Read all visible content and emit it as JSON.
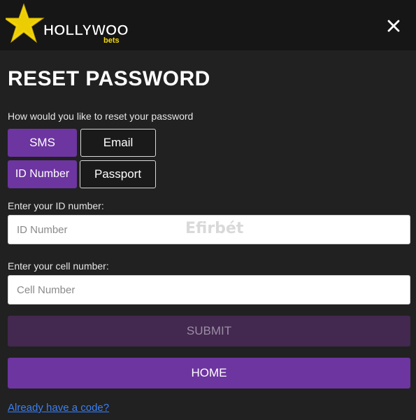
{
  "header": {
    "logo_main": "HOLLYWOOD",
    "logo_sub": "bets",
    "close_icon": "close-icon"
  },
  "page": {
    "title": "RESET PASSWORD",
    "prompt": "How would you like to reset your password"
  },
  "method_options": [
    {
      "label": "SMS",
      "selected": true
    },
    {
      "label": "Email",
      "selected": false
    }
  ],
  "id_options": [
    {
      "label": "ID Number",
      "selected": true
    },
    {
      "label": "Passport",
      "selected": false
    }
  ],
  "form": {
    "id_label": "Enter your ID number:",
    "id_placeholder": "ID Number",
    "id_value": "",
    "cell_label": "Enter your cell number:",
    "cell_placeholder": "Cell Number",
    "cell_value": ""
  },
  "watermark": "Efirbét",
  "buttons": {
    "submit": "SUBMIT",
    "home": "HOME"
  },
  "links": {
    "have_code": "Already have a code?"
  },
  "colors": {
    "accent": "#6d35a0",
    "submit_disabled": "#43284f",
    "background": "#212121",
    "header": "#161616",
    "logo_yellow": "#f5d80a",
    "link": "#3a7ff3"
  }
}
